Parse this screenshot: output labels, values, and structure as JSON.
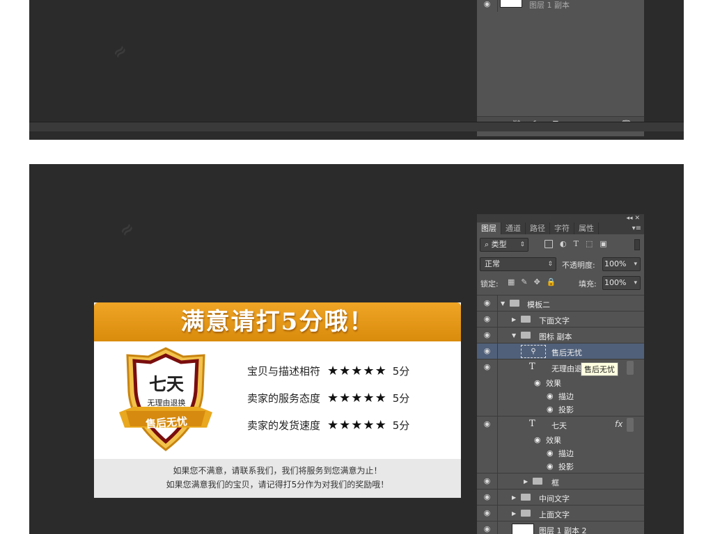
{
  "top_panel": {
    "partial_layer_name": "图层 1 副本",
    "bottom_icons": [
      "link-icon",
      "fx-icon",
      "mask-icon",
      "adjustment-icon",
      "folder-icon",
      "new-layer-icon",
      "trash-icon"
    ],
    "fx_label": "fx."
  },
  "panel": {
    "tabs": [
      "图层",
      "通道",
      "路径",
      "字符",
      "属性"
    ],
    "filter_kind": "类型",
    "blend_mode": "正常",
    "opacity_label": "不透明度:",
    "opacity_value": "100%",
    "lock_label": "锁定:",
    "fill_label": "填充:",
    "fill_value": "100%",
    "icon_T": "T",
    "fx_label": "fx",
    "layers": [
      {
        "name": "模板二"
      },
      {
        "name": "下面文字"
      },
      {
        "name": "图标 副本"
      },
      {
        "name": "售后无忧"
      },
      {
        "name": "无理由退换"
      },
      {
        "name": "效果"
      },
      {
        "name": "描边"
      },
      {
        "name": "投影"
      },
      {
        "name": "七天"
      },
      {
        "name": "效果"
      },
      {
        "name": "描边"
      },
      {
        "name": "投影"
      },
      {
        "name": "框"
      },
      {
        "name": "中间文字"
      },
      {
        "name": "上面文字"
      },
      {
        "name": "图层 1 副本 2"
      }
    ],
    "tooltip": "售后无忧"
  },
  "card": {
    "title": "满意请打5分哦！",
    "badge_main": "七天",
    "badge_sub": "无理由退换",
    "badge_ribbon": "售后无忧",
    "ratings": [
      {
        "label": "宝贝与描述相符",
        "stars": "★★★★★",
        "score": "5分"
      },
      {
        "label": "卖家的服务态度",
        "stars": "★★★★★",
        "score": "5分"
      },
      {
        "label": "卖家的发货速度",
        "stars": "★★★★★",
        "score": "5分"
      }
    ],
    "footer_line1": "如果您不满意，请联系我们，我们将服务到您满意为止！",
    "footer_line2": "如果您满意我们的宝贝，请记得打5分作为对我们的奖励哦！"
  },
  "colors": {
    "card_header": "#e39a17",
    "panel_bg": "#535353",
    "canvas_bg": "#2b2b2b",
    "selected_layer": "#50607a"
  }
}
